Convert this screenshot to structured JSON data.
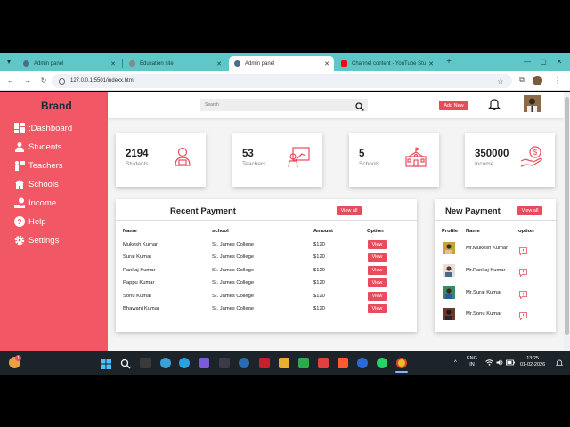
{
  "browser": {
    "tabs": [
      {
        "title": "Admin panel",
        "favicon_color": "#4b6b8c"
      },
      {
        "title": "Education site",
        "favicon_color": "#888888"
      },
      {
        "title": "Admin panel",
        "favicon_color": "#4b6b8c"
      },
      {
        "title": "Channel content - YouTube Stu",
        "favicon_color": "#ff0000"
      }
    ],
    "new_tab_label": "+",
    "url": "127.0.0.1:5501/indexx.html"
  },
  "sidebar": {
    "brand": "Brand",
    "items": [
      {
        "label": ":Dashboard",
        "icon": "dashboard-icon"
      },
      {
        "label": "Students",
        "icon": "students-icon"
      },
      {
        "label": "Teachers",
        "icon": "teachers-icon"
      },
      {
        "label": "Schools",
        "icon": "schools-icon"
      },
      {
        "label": "Income",
        "icon": "income-icon"
      },
      {
        "label": "Help",
        "icon": "help-icon"
      },
      {
        "label": "Settings",
        "icon": "gear-icon"
      }
    ]
  },
  "topbar": {
    "search_placeholder": "Search",
    "add_new_label": "Add New"
  },
  "cards": [
    {
      "value": "2194",
      "label": "Students",
      "icon": "student-icon"
    },
    {
      "value": "53",
      "label": "Teachers",
      "icon": "teacher-board-icon"
    },
    {
      "value": "5",
      "label": "Schools",
      "icon": "school-building-icon"
    },
    {
      "value": "350000",
      "label": "Income",
      "icon": "money-hand-icon"
    }
  ],
  "recent_payment": {
    "title": "Recent Payment",
    "view_all_label": "View all",
    "columns": [
      "Name",
      "school",
      "Amount",
      "Option"
    ],
    "rows": [
      {
        "name": "Mukesh Kumar",
        "school": "St. James College",
        "amount": "$120",
        "option": "View"
      },
      {
        "name": "Suraj Kumar",
        "school": "St. James College",
        "amount": "$120",
        "option": "View"
      },
      {
        "name": "Pankaj Kumar",
        "school": "St. James College",
        "amount": "$120",
        "option": "View"
      },
      {
        "name": "Pappu Kumar",
        "school": "St. James College",
        "amount": "$120",
        "option": "View"
      },
      {
        "name": "Sonu Kumar",
        "school": "St. James College",
        "amount": "$120",
        "option": "View"
      },
      {
        "name": "Bhawani Kumar",
        "school": "St. James College",
        "amount": "$120",
        "option": "View"
      }
    ]
  },
  "new_payment": {
    "title": "New Payment",
    "view_all_label": "View all",
    "columns": [
      "Profile",
      "Name",
      "option"
    ],
    "rows": [
      {
        "name": "Mr.Mukesh Kumar",
        "avatar_color": "#c9a03a"
      },
      {
        "name": "Mr.Pankaj Kumar",
        "avatar_color": "#b08a72"
      },
      {
        "name": "Mr.Suraj Kumar",
        "avatar_color": "#3a8a6a"
      },
      {
        "name": "Mr.Sonu Kumar",
        "avatar_color": "#6a3a2a"
      }
    ]
  },
  "taskbar": {
    "notification_badge": "1",
    "language": "ENG",
    "region": "IN",
    "time": "13:25",
    "date": "01-02-2026"
  },
  "colors": {
    "accent": "#e84c5c",
    "sidebar": "#f25766",
    "brand_text": "#1a2b3d"
  }
}
